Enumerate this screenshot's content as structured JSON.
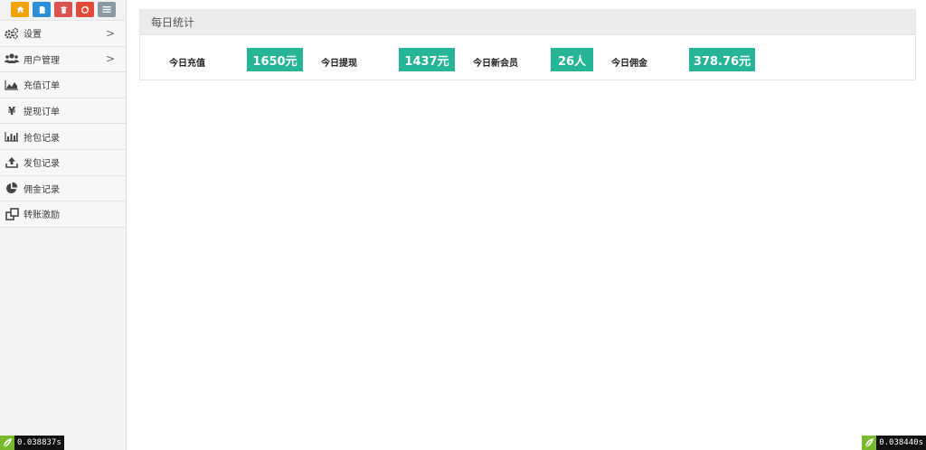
{
  "sidebar": {
    "shortcuts": [
      {
        "icon": "home-icon",
        "color": "#f0a30a"
      },
      {
        "icon": "document-icon",
        "color": "#2d8fd6"
      },
      {
        "icon": "trash-icon",
        "color": "#d9534f"
      },
      {
        "icon": "recycle-icon",
        "color": "#e04b3a"
      },
      {
        "icon": "list-icon",
        "color": "#8a9aa4"
      }
    ],
    "items": [
      {
        "label": "设置",
        "icon": "gears-icon",
        "has_arrow": true
      },
      {
        "label": "用户管理",
        "icon": "users-icon",
        "has_arrow": true
      },
      {
        "label": "充值订单",
        "icon": "area-chart-icon",
        "has_arrow": false
      },
      {
        "label": "提现订单",
        "icon": "yen-icon",
        "has_arrow": false
      },
      {
        "label": "抢包记录",
        "icon": "bar-chart-icon",
        "has_arrow": false
      },
      {
        "label": "发包记录",
        "icon": "upload-icon",
        "has_arrow": false
      },
      {
        "label": "佣金记录",
        "icon": "pie-chart-icon",
        "has_arrow": false
      },
      {
        "label": "转账激励",
        "icon": "transfer-icon",
        "has_arrow": false
      }
    ],
    "arrow_glyph": ">"
  },
  "panel": {
    "title": "每日统计",
    "stats": [
      {
        "label": "今日充值",
        "value": "1650元"
      },
      {
        "label": "今日提现",
        "value": "1437元"
      },
      {
        "label": "今日新会员",
        "value": "26人"
      },
      {
        "label": "今日佣金",
        "value": "378.76元"
      }
    ],
    "badge_color": "#26b597"
  },
  "timers": {
    "left": "0.038837s",
    "right": "0.038440s"
  }
}
